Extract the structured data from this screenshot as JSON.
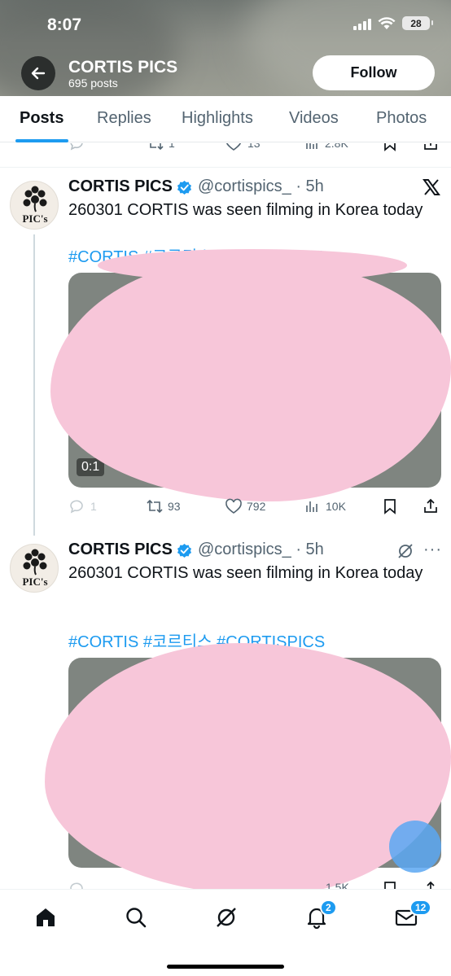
{
  "status_bar": {
    "time": "8:07",
    "battery": "28"
  },
  "header": {
    "name": "CORTIS PICS",
    "posts_count": "695 posts",
    "follow_label": "Follow"
  },
  "tabs": [
    {
      "label": "Posts",
      "active": true
    },
    {
      "label": "Replies"
    },
    {
      "label": "Highlights"
    },
    {
      "label": "Videos"
    },
    {
      "label": "Photos"
    }
  ],
  "prev_tweet_actions": {
    "reposts": "1",
    "likes": "13",
    "views": "2.8K"
  },
  "tweets": [
    {
      "name": "CORTIS PICS",
      "handle_time": "@cortispics_ · 5h",
      "text": "260301 CORTIS was seen filming in Korea today",
      "tags": "#CORTIS #코르티스 #CORTISPICS",
      "video_time": "0:1",
      "replies": "1",
      "reposts": "93",
      "likes": "792",
      "views": "10K"
    },
    {
      "name": "CORTIS PICS",
      "handle_time": "@cortispics_ · 5h",
      "text": "260301 CORTIS was seen filming in Korea today",
      "tags": "#CORTIS #코르티스 #CORTISPICS",
      "views": "1.5K"
    }
  ],
  "avatar_text": "PIC's",
  "bottom_nav": {
    "notifications_badge": "2",
    "messages_badge": "12"
  },
  "colors": {
    "accent": "#1d9bf0",
    "overlay_pink": "#f7c6d9",
    "text_secondary": "#536471"
  }
}
